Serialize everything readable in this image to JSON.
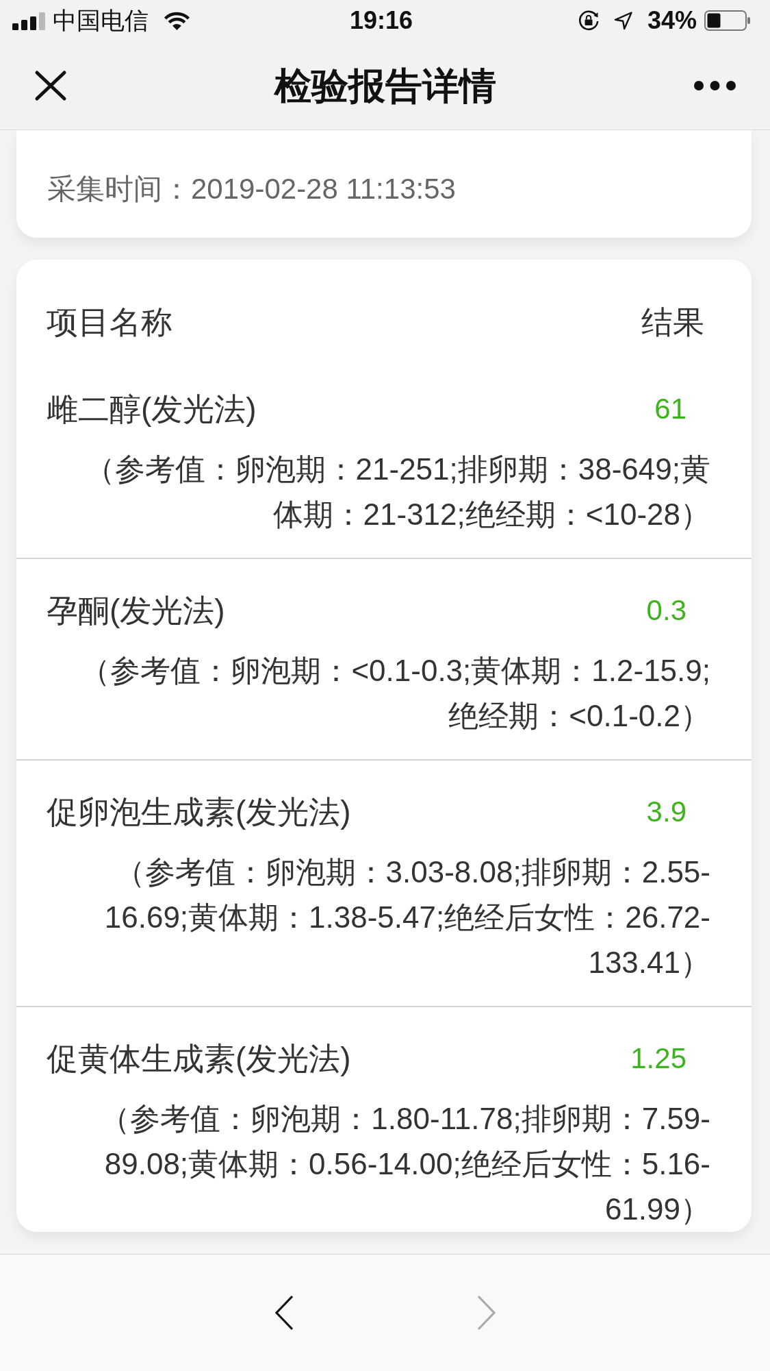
{
  "status_bar": {
    "carrier": "中国电信",
    "time": "19:16",
    "battery": "34%"
  },
  "nav_bar": {
    "title": "检验报告详情"
  },
  "info_card": {
    "fields": [
      {
        "label": "采集时间：",
        "value": "2019-02-28 11:13:53"
      }
    ]
  },
  "table": {
    "columns": [
      "项目名称",
      "结果"
    ],
    "rows": [
      {
        "name": "雌二醇(发光法)",
        "result": "61",
        "reference": "（参考值：卵泡期：21-251;排卵期：38-649;黄体期：21-312;绝经期：<10-28）",
        "abnormal": false
      },
      {
        "name": "孕酮(发光法)",
        "result": "0.3",
        "reference": "（参考值：卵泡期：<0.1-0.3;黄体期：1.2-15.9;绝经期：<0.1-0.2）",
        "abnormal": false
      },
      {
        "name": "促卵泡生成素(发光法)",
        "result": "3.9",
        "reference": "（参考值：卵泡期：3.03-8.08;排卵期：2.55-16.69;黄体期：1.38-5.47;绝经后女性：26.72-133.41）",
        "abnormal": false
      },
      {
        "name": "促黄体生成素(发光法)",
        "result": "1.25",
        "reference": "（参考值：卵泡期：1.80-11.78;排卵期：7.59-89.08;黄体期：0.56-14.00;绝经后女性：5.16-61.99）",
        "abnormal": false
      }
    ]
  },
  "bottom_bar": {
    "buttons": [
      {
        "kind": "back",
        "disabled": false
      },
      {
        "kind": "forward",
        "disabled": true
      }
    ]
  }
}
